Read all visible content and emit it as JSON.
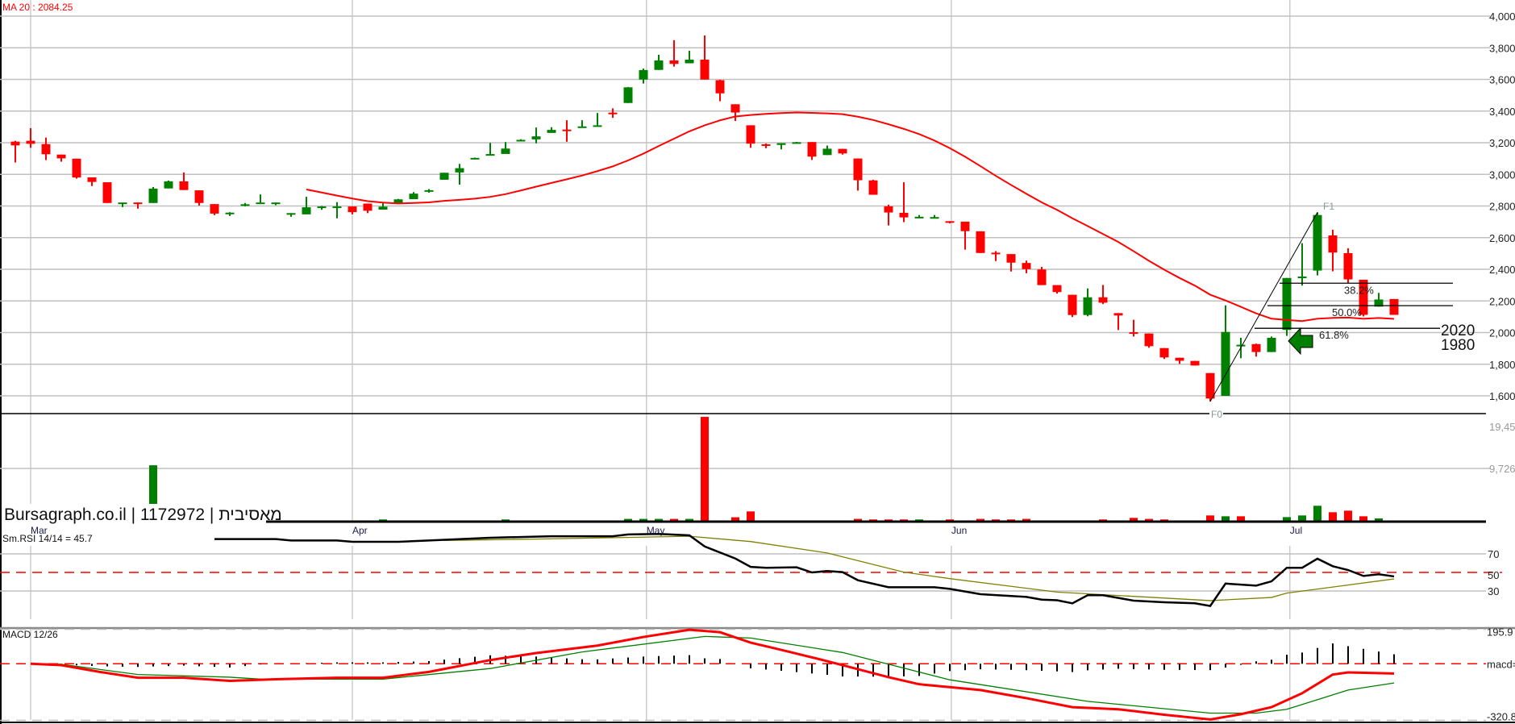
{
  "header": {
    "ma_label": "MA 20 : 2084.25"
  },
  "watermark": "Bursagraph.co.il | 1172972 | מאסיבית",
  "colors": {
    "up": "#008000",
    "down": "#ff0000",
    "ma": "#ff0000",
    "rsi": "#000000",
    "rsi_signal": "#808000",
    "macd": "#ff0000",
    "macd_signal": "#008000",
    "grid": "#c0c0c0"
  },
  "chart_data": [
    {
      "type": "candlestick",
      "title": "MA 20 : 2084.25",
      "ylim": [
        1600,
        4000
      ],
      "y_ticks": [
        "4,000",
        "3,800",
        "3,600",
        "3,400",
        "3,200",
        "3,000",
        "2,800",
        "2,600",
        "2,400",
        "2,200",
        "2,000",
        "1,800",
        "1,600"
      ],
      "y_tick_values": [
        4000,
        3800,
        3600,
        3400,
        3200,
        3000,
        2800,
        2600,
        2400,
        2200,
        2000,
        1800,
        1600
      ],
      "months": [
        {
          "label": "Mar",
          "index": 1
        },
        {
          "label": "Apr",
          "index": 22
        },
        {
          "label": "May",
          "index": 41.2
        },
        {
          "label": "Jun",
          "index": 61.1
        },
        {
          "label": "Jul",
          "index": 83.2
        }
      ],
      "ma_period": 20,
      "ohlc": [
        [
          3207,
          3212,
          3075,
          3183
        ],
        [
          3212,
          3292,
          3168,
          3193
        ],
        [
          3191,
          3232,
          3090,
          3127
        ],
        [
          3125,
          3125,
          3080,
          3101
        ],
        [
          3099,
          3099,
          2973,
          2980
        ],
        [
          2981,
          2981,
          2926,
          2952
        ],
        [
          2950,
          2950,
          2819,
          2819
        ],
        [
          2816,
          2822,
          2793,
          2822
        ],
        [
          2822,
          2822,
          2783,
          2816
        ],
        [
          2819,
          2920,
          2819,
          2910
        ],
        [
          2911,
          2961,
          2911,
          2956
        ],
        [
          2956,
          3012,
          2901,
          2901
        ],
        [
          2899,
          2899,
          2803,
          2819
        ],
        [
          2812,
          2812,
          2742,
          2752
        ],
        [
          2754,
          2761,
          2737,
          2758
        ],
        [
          2808,
          2819,
          2798,
          2811
        ],
        [
          2816,
          2873,
          2816,
          2822
        ],
        [
          2817,
          2822,
          2805,
          2822
        ],
        [
          2750,
          2755,
          2732,
          2755
        ],
        [
          2747,
          2858,
          2747,
          2792
        ],
        [
          2793,
          2800,
          2776,
          2797
        ],
        [
          2795,
          2824,
          2722,
          2797
        ],
        [
          2797,
          2797,
          2747,
          2761
        ],
        [
          2815,
          2815,
          2755,
          2770
        ],
        [
          2777,
          2825,
          2777,
          2796
        ],
        [
          2815,
          2845,
          2815,
          2842
        ],
        [
          2843,
          2888,
          2843,
          2878
        ],
        [
          2897,
          2907,
          2884,
          2900
        ],
        [
          2966,
          3010,
          2966,
          3010
        ],
        [
          3012,
          3066,
          2935,
          3039
        ],
        [
          3100,
          3106,
          3100,
          3104
        ],
        [
          3126,
          3199,
          3126,
          3128
        ],
        [
          3129,
          3204,
          3129,
          3163
        ],
        [
          3214,
          3222,
          3214,
          3218
        ],
        [
          3221,
          3296,
          3196,
          3240
        ],
        [
          3262,
          3298,
          3262,
          3281
        ],
        [
          3283,
          3342,
          3206,
          3281
        ],
        [
          3301,
          3342,
          3301,
          3303
        ],
        [
          3308,
          3388,
          3308,
          3310
        ],
        [
          3390,
          3417,
          3357,
          3387
        ],
        [
          3451,
          3552,
          3451,
          3550
        ],
        [
          3599,
          3669,
          3574,
          3659
        ],
        [
          3660,
          3756,
          3660,
          3720
        ],
        [
          3720,
          3848,
          3681,
          3698
        ],
        [
          3702,
          3781,
          3702,
          3725
        ],
        [
          3725,
          3878,
          3599,
          3599
        ],
        [
          3595,
          3598,
          3462,
          3512
        ],
        [
          3443,
          3443,
          3337,
          3391
        ],
        [
          3310,
          3310,
          3168,
          3194
        ],
        [
          3190,
          3195,
          3165,
          3185
        ],
        [
          3186,
          3197,
          3158,
          3197
        ],
        [
          3199,
          3205,
          3199,
          3203
        ],
        [
          3204,
          3204,
          3091,
          3112
        ],
        [
          3122,
          3182,
          3122,
          3162
        ],
        [
          3161,
          3161,
          3125,
          3132
        ],
        [
          3100,
          3100,
          2897,
          2963
        ],
        [
          2962,
          2966,
          2871,
          2871
        ],
        [
          2798,
          2808,
          2677,
          2759
        ],
        [
          2757,
          2950,
          2698,
          2728
        ],
        [
          2724,
          2743,
          2724,
          2732
        ],
        [
          2726,
          2743,
          2726,
          2730
        ],
        [
          2704,
          2704,
          2690,
          2698
        ],
        [
          2701,
          2701,
          2524,
          2641
        ],
        [
          2640,
          2640,
          2503,
          2503
        ],
        [
          2505,
          2515,
          2452,
          2501
        ],
        [
          2496,
          2496,
          2386,
          2442
        ],
        [
          2440,
          2455,
          2375,
          2401
        ],
        [
          2399,
          2415,
          2300,
          2300
        ],
        [
          2300,
          2300,
          2246,
          2256
        ],
        [
          2239,
          2239,
          2098,
          2111
        ],
        [
          2111,
          2279,
          2103,
          2223
        ],
        [
          2223,
          2301,
          2180,
          2189
        ],
        [
          2123,
          2123,
          2016,
          2108
        ],
        [
          2002,
          2081,
          1975,
          1997
        ],
        [
          1994,
          1994,
          1904,
          1914
        ],
        [
          1902,
          1902,
          1833,
          1843
        ],
        [
          1841,
          1841,
          1802,
          1822
        ],
        [
          1821,
          1821,
          1792,
          1792
        ],
        [
          1744,
          1744,
          1564,
          1583
        ],
        [
          1600,
          2172,
          1600,
          2004
        ],
        [
          1918,
          1967,
          1838,
          1923
        ],
        [
          1927,
          1930,
          1848,
          1877
        ],
        [
          1877,
          1975,
          1877,
          1967
        ],
        [
          2017,
          2345,
          1979,
          2345
        ],
        [
          2350,
          2565,
          2297,
          2354
        ],
        [
          2392,
          2760,
          2361,
          2743
        ],
        [
          2614,
          2650,
          2387,
          2506
        ],
        [
          2502,
          2533,
          2311,
          2336
        ],
        [
          2334,
          2334,
          2102,
          2112
        ],
        [
          2164,
          2251,
          2164,
          2209
        ],
        [
          2212,
          2212,
          2112,
          2112
        ]
      ],
      "fibonacci": {
        "f0_label": "F0",
        "f1_label": "F1",
        "f0_index": 78,
        "f0_value": 1564,
        "f1_index": 85,
        "f1_value": 2760,
        "levels": [
          {
            "label": "38.2%",
            "value": 2312
          },
          {
            "label": "50.0%",
            "value": 2170
          },
          {
            "label": "61.8%",
            "value": 2027
          }
        ],
        "targets": [
          "2020",
          "1980"
        ]
      },
      "arrow": {
        "index": 83,
        "value": 1950,
        "direction": "left"
      }
    },
    {
      "type": "bar",
      "title": "Volume",
      "ylim": [
        0,
        19453
      ],
      "y_ticks": [
        "19,453",
        "9,726"
      ],
      "y_tick_values": [
        19453,
        9726
      ],
      "bars": [
        [
          9,
          10300,
          "up"
        ],
        [
          17,
          200,
          "down"
        ],
        [
          21,
          200,
          "up"
        ],
        [
          24,
          400,
          "up"
        ],
        [
          31,
          200,
          "up"
        ],
        [
          32,
          400,
          "up"
        ],
        [
          34,
          200,
          "up"
        ],
        [
          35,
          200,
          "up"
        ],
        [
          36,
          200,
          "down"
        ],
        [
          37,
          200,
          "up"
        ],
        [
          38,
          200,
          "up"
        ],
        [
          39,
          200,
          "up"
        ],
        [
          40,
          500,
          "up"
        ],
        [
          41,
          500,
          "up"
        ],
        [
          42,
          500,
          "up"
        ],
        [
          43,
          500,
          "down"
        ],
        [
          44,
          500,
          "up"
        ],
        [
          45,
          19150,
          "down"
        ],
        [
          46,
          200,
          "down"
        ],
        [
          47,
          800,
          "down"
        ],
        [
          48,
          1870,
          "down"
        ],
        [
          49,
          200,
          "down"
        ],
        [
          52,
          200,
          "down"
        ],
        [
          54,
          200,
          "down"
        ],
        [
          55,
          500,
          "down"
        ],
        [
          56,
          400,
          "down"
        ],
        [
          57,
          400,
          "down"
        ],
        [
          58,
          400,
          "down"
        ],
        [
          59,
          400,
          "up"
        ],
        [
          60,
          200,
          "up"
        ],
        [
          61,
          400,
          "down"
        ],
        [
          62,
          200,
          "down"
        ],
        [
          63,
          500,
          "down"
        ],
        [
          64,
          400,
          "down"
        ],
        [
          65,
          400,
          "down"
        ],
        [
          66,
          500,
          "down"
        ],
        [
          67,
          200,
          "down"
        ],
        [
          68,
          200,
          "down"
        ],
        [
          69,
          200,
          "down"
        ],
        [
          71,
          400,
          "down"
        ],
        [
          72,
          200,
          "down"
        ],
        [
          73,
          690,
          "down"
        ],
        [
          74,
          500,
          "down"
        ],
        [
          75,
          400,
          "down"
        ],
        [
          77,
          200,
          "down"
        ],
        [
          78,
          1130,
          "down"
        ],
        [
          79,
          980,
          "up"
        ],
        [
          80,
          980,
          "down"
        ],
        [
          81,
          200,
          "down"
        ],
        [
          82,
          200,
          "up"
        ],
        [
          83,
          830,
          "up"
        ],
        [
          84,
          1130,
          "up"
        ],
        [
          85,
          2900,
          "up"
        ],
        [
          86,
          1720,
          "down"
        ],
        [
          87,
          2010,
          "down"
        ],
        [
          88,
          980,
          "down"
        ],
        [
          89,
          590,
          "up"
        ]
      ]
    },
    {
      "type": "line",
      "title": "Sm.RSI 14/14 = 45.7",
      "ylim": [
        0,
        100
      ],
      "y_ticks": [
        "70",
        "50",
        "30"
      ],
      "y_tick_values": [
        70,
        50,
        30
      ],
      "rsi": [
        [
          13,
          86
        ],
        [
          17,
          86
        ],
        [
          18,
          84.5
        ],
        [
          21,
          84.5
        ],
        [
          22,
          83
        ],
        [
          25,
          83
        ],
        [
          27,
          84.5
        ],
        [
          31,
          87.4
        ],
        [
          35,
          89
        ],
        [
          39,
          89
        ],
        [
          40,
          91
        ],
        [
          42,
          91.5
        ],
        [
          44,
          90
        ],
        [
          45,
          78
        ],
        [
          47,
          65
        ],
        [
          48,
          56
        ],
        [
          49,
          55
        ],
        [
          51,
          55.5
        ],
        [
          52,
          50
        ],
        [
          53,
          51.5
        ],
        [
          54,
          50.3
        ],
        [
          55,
          41.6
        ],
        [
          57,
          34
        ],
        [
          60,
          34
        ],
        [
          61,
          32.3
        ],
        [
          63,
          26.5
        ],
        [
          66,
          23.6
        ],
        [
          67,
          20.7
        ],
        [
          68,
          20
        ],
        [
          69,
          16.7
        ],
        [
          70,
          25.4
        ],
        [
          71,
          25.4
        ],
        [
          73,
          19.6
        ],
        [
          75,
          17.8
        ],
        [
          77,
          16.7
        ],
        [
          78,
          13.8
        ],
        [
          79,
          38
        ],
        [
          81,
          35.8
        ],
        [
          82,
          40.4
        ],
        [
          83,
          55
        ],
        [
          84,
          55
        ],
        [
          85,
          64.8
        ],
        [
          86,
          56.7
        ],
        [
          87,
          52.6
        ],
        [
          88,
          46.2
        ],
        [
          89,
          48
        ],
        [
          90,
          45.7
        ]
      ],
      "signal": [
        [
          28,
          84.5
        ],
        [
          34,
          86
        ],
        [
          44,
          89
        ],
        [
          48,
          83.3
        ],
        [
          53,
          71
        ],
        [
          58,
          50.3
        ],
        [
          61,
          43.3
        ],
        [
          68,
          28.8
        ],
        [
          78,
          19.6
        ],
        [
          82,
          23
        ],
        [
          83,
          27.7
        ],
        [
          90,
          43
        ]
      ]
    },
    {
      "type": "line",
      "title": "MACD 12/26",
      "ylim": [
        -320.8,
        195.9
      ],
      "y_ticks": [
        "195.9",
        "macd=",
        "-320.8"
      ],
      "y_tick_values": [
        195.9,
        0,
        -320.8
      ],
      "macd": [
        [
          1,
          0
        ],
        [
          3,
          -8
        ],
        [
          5.5,
          -46
        ],
        [
          8,
          -79
        ],
        [
          11,
          -79
        ],
        [
          14,
          -97
        ],
        [
          17,
          -88
        ],
        [
          21,
          -79
        ],
        [
          24,
          -79
        ],
        [
          27,
          -46
        ],
        [
          31,
          21
        ],
        [
          34,
          61
        ],
        [
          38,
          103
        ],
        [
          41,
          152
        ],
        [
          44,
          193
        ],
        [
          46,
          179
        ],
        [
          48,
          120
        ],
        [
          50,
          79
        ],
        [
          53,
          15
        ],
        [
          57,
          -76
        ],
        [
          59,
          -116
        ],
        [
          63,
          -149
        ],
        [
          66,
          -195
        ],
        [
          69,
          -246
        ],
        [
          72,
          -258
        ],
        [
          75,
          -289
        ],
        [
          78,
          -316
        ],
        [
          80,
          -286
        ],
        [
          82,
          -246
        ],
        [
          84,
          -167
        ],
        [
          86,
          -61
        ],
        [
          87,
          -49
        ],
        [
          90,
          -55
        ]
      ],
      "signal": [
        [
          1,
          0
        ],
        [
          3,
          -3
        ],
        [
          8,
          -61
        ],
        [
          14,
          -76
        ],
        [
          16,
          -87
        ],
        [
          24,
          -87
        ],
        [
          31,
          -27
        ],
        [
          37,
          67
        ],
        [
          45,
          155
        ],
        [
          48,
          146
        ],
        [
          54,
          64
        ],
        [
          61,
          -91
        ],
        [
          70,
          -213
        ],
        [
          78,
          -280
        ],
        [
          81,
          -280
        ],
        [
          83,
          -258
        ],
        [
          87,
          -149
        ],
        [
          90,
          -109
        ]
      ]
    }
  ]
}
